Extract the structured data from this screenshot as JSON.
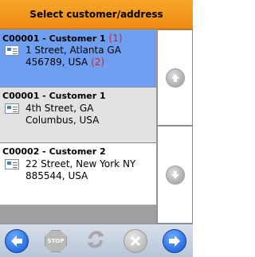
{
  "header": {
    "title": "Select customer/address"
  },
  "rows": [
    {
      "title": "C00001 - Customer 1",
      "marker": "(1)",
      "address_line1": "1 Street, Atlanta GA",
      "address_line2": "456789, USA",
      "address_marker": "(2)",
      "selected": true
    },
    {
      "title": "C00001 - Customer 1",
      "address_line1": "4th Street,  GA",
      "address_line2": "Columbus, USA",
      "selected": false
    },
    {
      "title": "C00002 - Customer 2",
      "address_line1": "22 Street, New York NY",
      "address_line2": "885544, USA",
      "selected": false
    }
  ],
  "side_buttons": {
    "up_icon": "arrow-up-icon",
    "down_icon": "arrow-down-icon"
  },
  "toolbar": {
    "back_icon": "arrow-left-icon",
    "stop_label": "STOP",
    "refresh_icon": "refresh-icon",
    "cancel_icon": "close-icon",
    "forward_icon": "arrow-right-icon"
  },
  "colors": {
    "header": "#f39a1c",
    "selected_row": "#6f9ff0",
    "alt_row": "#e2e2e2",
    "toolbar_blue": "#1a5fd8",
    "marker_red": "#d62020"
  }
}
